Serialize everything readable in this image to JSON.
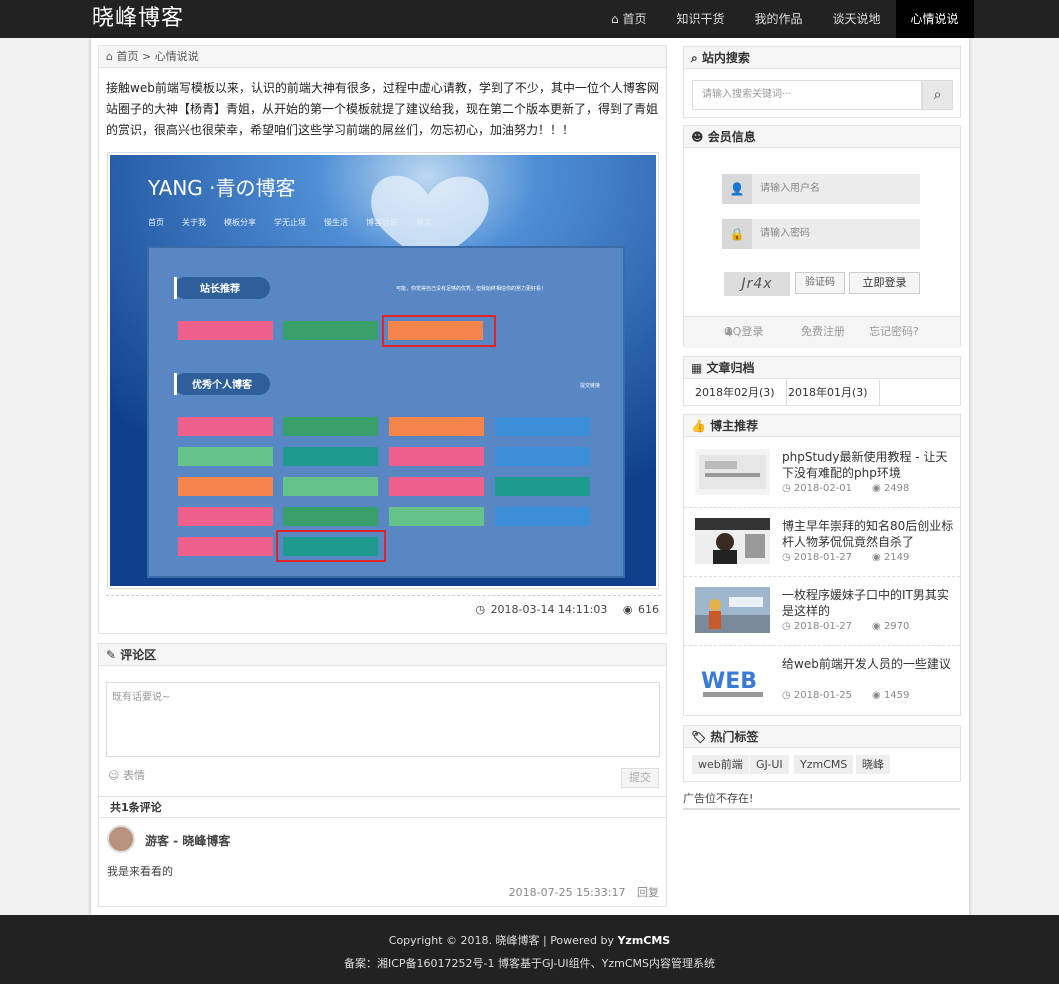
{
  "site": {
    "logo": "晓峰博客"
  },
  "nav": [
    "首页",
    "知识干货",
    "我的作品",
    "谈天说地",
    "心情说说"
  ],
  "breadcrumb": {
    "home": "首页",
    "sep": ">",
    "current": "心情说说"
  },
  "article": {
    "text": "接触web前端写模板以来，认识的前端大神有很多，过程中虚心请教，学到了不少，其中一位个人博客网站圈子的大神【杨青】青姐，从开始的第一个模板就提了建议给我，现在第二个版本更新了，得到了青姐的赏识，很高兴也很荣幸，希望咱们这些学习前端的屌丝们，勿忘初心，加油努力！！！",
    "date": "2018-03-14 14:11:03",
    "views": "616"
  },
  "shot": {
    "title": "YANG ·青の博客",
    "nav": [
      "首页",
      "关于我",
      "模板分享",
      "学无止境",
      "慢生活",
      "博客导航",
      "留言"
    ],
    "section1": "站长推荐",
    "section1_note": "可能，你觉得自己没有足够的优秀，但我始终相信你的努力更好看！",
    "section2": "优秀个人博客",
    "section2_link": "提交链接"
  },
  "comments": {
    "title": "评论区",
    "placeholder": "既有话要说~",
    "emoji": "表情",
    "submit": "提交",
    "count": "共1条评论",
    "user": "游客 - 晓峰博客",
    "text": "我是来看看的",
    "time": "2018-07-25 15:33:17",
    "reply": "回复"
  },
  "sidebar": {
    "search": {
      "title": "站内搜索",
      "placeholder": "请输入搜索关键词···"
    },
    "member": {
      "title": "会员信息",
      "username": "请输入用户名",
      "password": "请输入密码",
      "captcha": "Jr4x",
      "captcha_btn": "验证码",
      "login_btn": "立即登录",
      "qq": "QQ登录",
      "register": "免费注册",
      "forgot": "忘记密码?"
    },
    "archive": {
      "title": "文章归档",
      "items": [
        "2018年02月(3)",
        "2018年01月(3)"
      ]
    },
    "recommend": {
      "title": "博主推荐",
      "items": [
        {
          "title": "phpStudy最新使用教程 - 让天下没有难配的php环境",
          "date": "2018-02-01",
          "views": "2498"
        },
        {
          "title": "博主早年崇拜的知名80后创业标杆人物茅侃侃竟然自杀了",
          "date": "2018-01-27",
          "views": "2149"
        },
        {
          "title": "一枚程序媛妹子口中的IT男其实是这样的",
          "date": "2018-01-27",
          "views": "2970"
        },
        {
          "title": "给web前端开发人员的一些建议",
          "date": "2018-01-25",
          "views": "1459"
        }
      ]
    },
    "tags": {
      "title": "热门标签",
      "items": [
        "web前端",
        "GJ-UI",
        "YzmCMS",
        "晓峰"
      ]
    },
    "ad": "广告位不存在!"
  },
  "footer": {
    "copyright_prefix": "Copyright © 2018. 晓峰博客 | Powered by ",
    "powered": "YzmCMS",
    "icp": "备案：湘ICP备16017252号-1 博客基于GJ-UI组件、YzmCMS内容管理系统"
  },
  "colors": {
    "topbar": "#222222",
    "accent_active": "#000000",
    "screenshot_bg": "#2a63b5"
  }
}
